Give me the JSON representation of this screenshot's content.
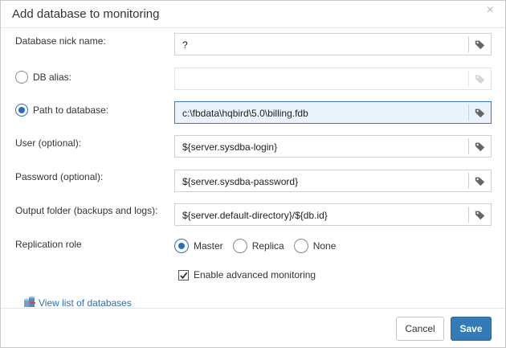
{
  "dialog": {
    "title": "Add database to monitoring",
    "close_glyph": "×"
  },
  "form": {
    "nickname": {
      "label": "Database nick name:",
      "value": "?"
    },
    "db_alias": {
      "label": "DB alias:",
      "value": "",
      "selected": false
    },
    "path": {
      "label": "Path to database:",
      "value": "c:\\fbdata\\hqbird\\5.0\\billing.fdb",
      "selected": true
    },
    "user": {
      "label": "User (optional):",
      "value": "${server.sysdba-login}"
    },
    "password": {
      "label": "Password (optional):",
      "value": "${server.sysdba-password}"
    },
    "output": {
      "label": "Output folder (backups and logs):",
      "value": "${server.default-directory}/${db.id}"
    },
    "replication": {
      "label": "Replication role",
      "options": [
        "Master",
        "Replica",
        "None"
      ],
      "selected": "Master"
    },
    "advanced": {
      "label": "Enable advanced monitoring",
      "checked": true
    }
  },
  "link": {
    "label": "View list of databases",
    "icon": "database-list-icon"
  },
  "footer": {
    "cancel_label": "Cancel",
    "save_label": "Save"
  },
  "colors": {
    "accent": "#337ab7",
    "focus_bg": "#eaf2fb",
    "link": "#2a6ebb"
  }
}
